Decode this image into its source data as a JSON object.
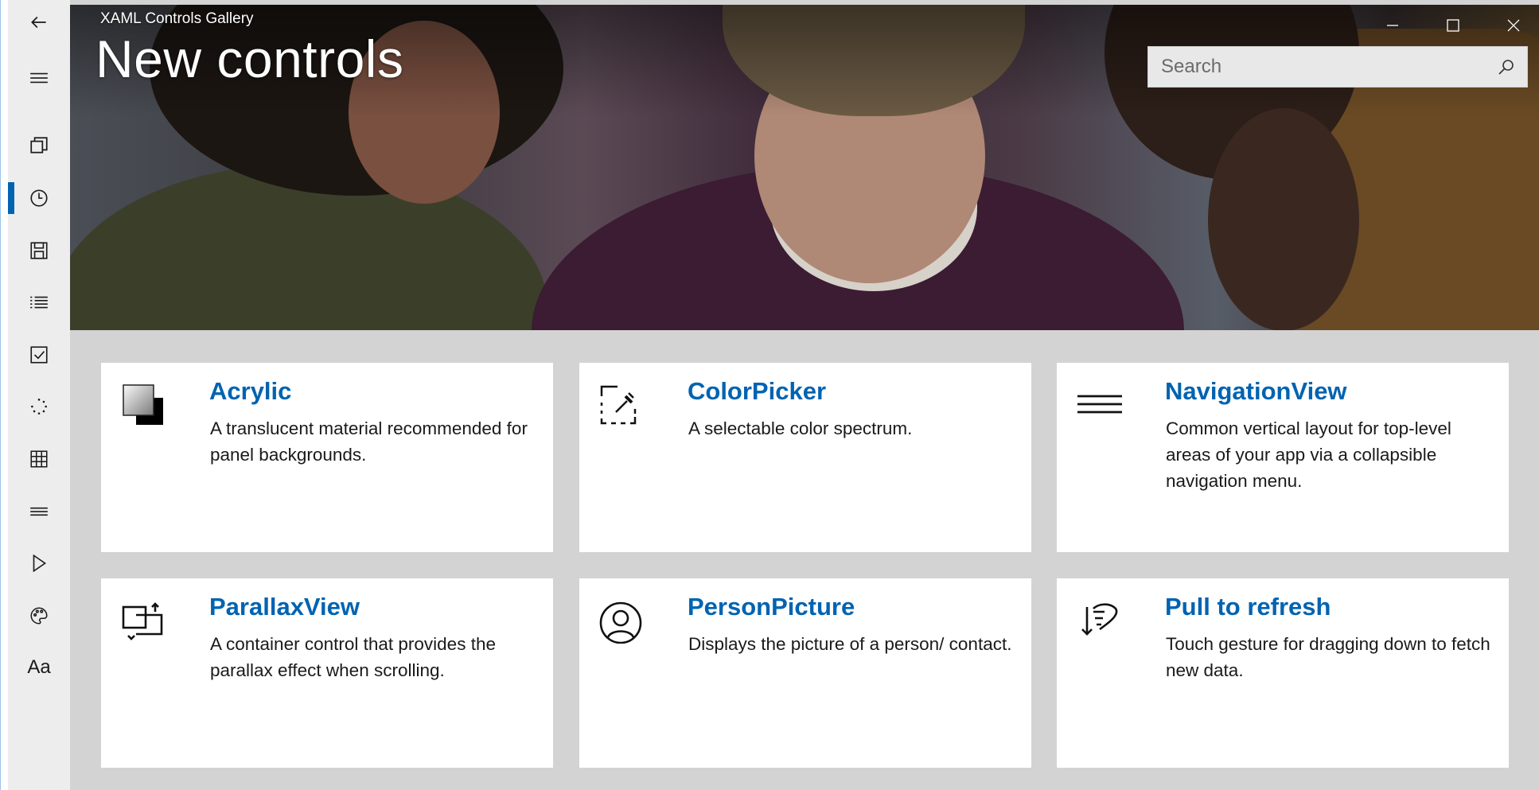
{
  "window": {
    "app_title": "XAML Controls Gallery",
    "page_title": "New controls",
    "minimize_label": "—",
    "maximize_label": "☐",
    "close_label": "✕"
  },
  "search": {
    "placeholder": "Search",
    "value": ""
  },
  "nav": {
    "items": [
      {
        "icon": "back-arrow-icon"
      },
      {
        "icon": "hamburger-menu-icon"
      },
      {
        "icon": "all-controls-icon"
      },
      {
        "icon": "clock-icon",
        "selected": true
      },
      {
        "icon": "save-icon"
      },
      {
        "icon": "list-icon"
      },
      {
        "icon": "checkbox-icon"
      },
      {
        "icon": "progress-ring-icon"
      },
      {
        "icon": "grid-icon"
      },
      {
        "icon": "menu-lines-icon"
      },
      {
        "icon": "play-icon"
      },
      {
        "icon": "palette-icon"
      },
      {
        "icon": "typography-icon",
        "label": "Aa"
      }
    ]
  },
  "cards": [
    {
      "title": "Acrylic",
      "description": "A translucent material recommended for panel backgrounds.",
      "icon": "acrylic-icon"
    },
    {
      "title": "ColorPicker",
      "description": "A selectable color spectrum.",
      "icon": "color-picker-icon"
    },
    {
      "title": "NavigationView",
      "description": "Common vertical layout for top-level areas of your app via a collapsible navigation menu.",
      "icon": "navigation-view-icon"
    },
    {
      "title": "ParallaxView",
      "description": "A container control that provides the parallax effect when scrolling.",
      "icon": "parallax-view-icon"
    },
    {
      "title": "PersonPicture",
      "description": "Displays the picture of a person/ contact.",
      "icon": "person-picture-icon"
    },
    {
      "title": "Pull to refresh",
      "description": "Touch gesture for dragging down to fetch new data.",
      "icon": "pull-to-refresh-icon"
    }
  ],
  "colors": {
    "accent": "#0063b1",
    "nav_background": "#ededed",
    "content_background": "#d3d3d3",
    "card_background": "#ffffff"
  }
}
